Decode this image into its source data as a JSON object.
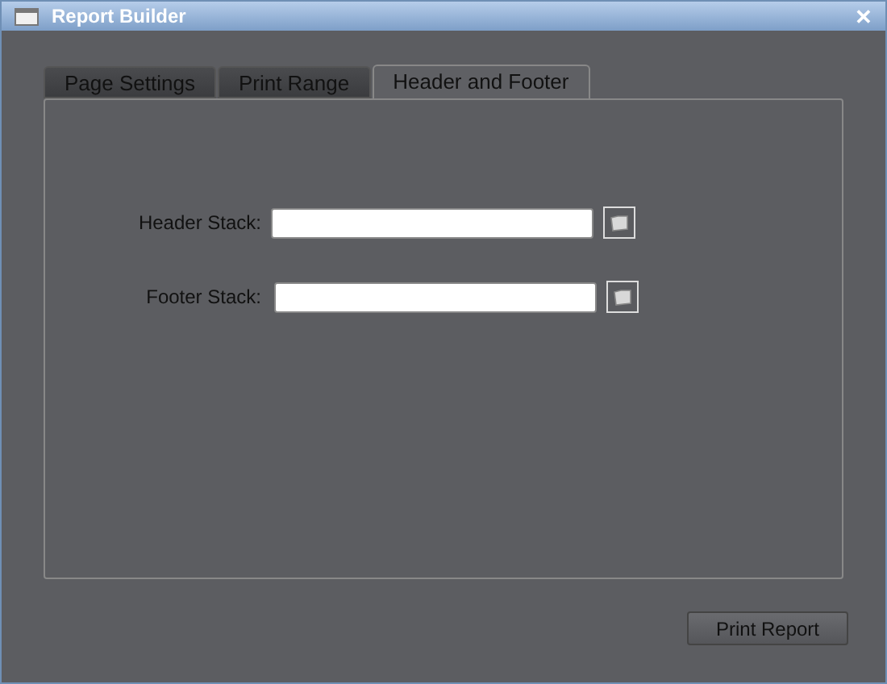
{
  "window": {
    "title": "Report Builder",
    "close": "✕"
  },
  "tabs": [
    {
      "label": "Page Settings",
      "selected": false
    },
    {
      "label": "Print Range",
      "selected": false
    },
    {
      "label": "Header and Footer",
      "selected": true
    }
  ],
  "fields": [
    {
      "label": "Header Stack:"
    },
    {
      "label": "Footer Stack:"
    }
  ],
  "buttons": [
    "Print Report"
  ]
}
